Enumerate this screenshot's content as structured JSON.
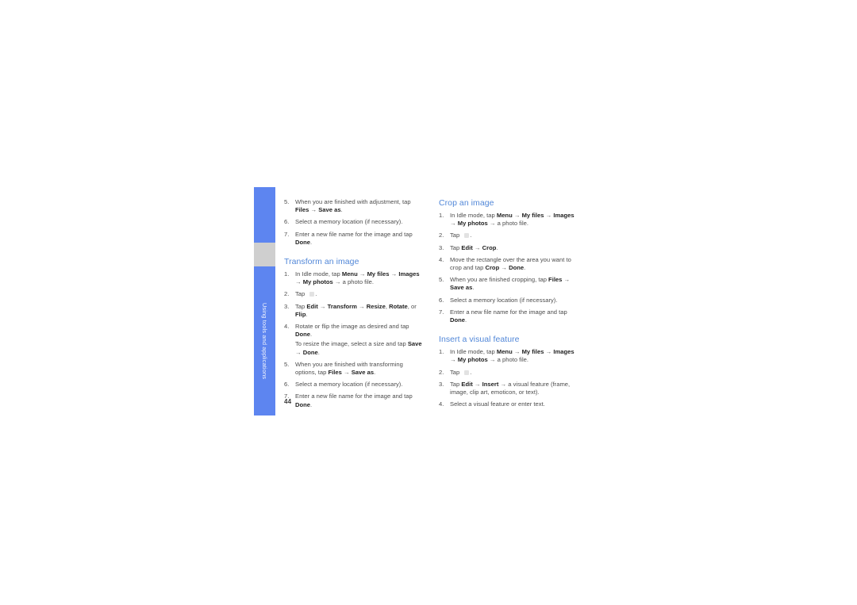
{
  "page": {
    "folio": "44",
    "heading_color": "#5187d8",
    "tab_color": "#5d85f0",
    "tab_gray_color": "#cfcfcf",
    "body_text_color": "#4d4d4d"
  },
  "side_tab": {
    "label": "Using tools and applications"
  },
  "left_column": {
    "continued_steps": [
      {
        "number": "5.",
        "parts": [
          {
            "t": "When you are finished with adjustment, tap ",
            "b": false
          },
          {
            "t": "Files",
            "b": true
          },
          {
            "t": " → ",
            "b": false
          },
          {
            "t": "Save as",
            "b": true
          },
          {
            "t": ".",
            "b": false
          }
        ]
      },
      {
        "number": "6.",
        "parts": [
          {
            "t": "Select a memory location (if necessary).",
            "b": false
          }
        ]
      },
      {
        "number": "7.",
        "parts": [
          {
            "t": "Enter a new file name for the image and tap ",
            "b": false
          },
          {
            "t": "Done",
            "b": true
          },
          {
            "t": ".",
            "b": false
          }
        ]
      }
    ],
    "section": {
      "heading": "Transform an image",
      "steps": [
        {
          "number": "1.",
          "parts": [
            {
              "t": "In Idle mode, tap ",
              "b": false
            },
            {
              "t": "Menu",
              "b": true
            },
            {
              "t": " → ",
              "b": false
            },
            {
              "t": "My files",
              "b": true
            },
            {
              "t": " → ",
              "b": false
            },
            {
              "t": "Images",
              "b": true
            },
            {
              "t": " → ",
              "b": false
            },
            {
              "t": "My photos",
              "b": true
            },
            {
              "t": " → a photo file.",
              "b": false
            }
          ]
        },
        {
          "number": "2.",
          "parts": [
            {
              "t": "Tap",
              "b": false
            },
            {
              "t": "[icon]",
              "b": false,
              "icon": true
            },
            {
              "t": ".",
              "b": false
            }
          ]
        },
        {
          "number": "3.",
          "parts": [
            {
              "t": "Tap ",
              "b": false
            },
            {
              "t": "Edit",
              "b": true
            },
            {
              "t": " → ",
              "b": false
            },
            {
              "t": "Transform",
              "b": true
            },
            {
              "t": " → ",
              "b": false
            },
            {
              "t": "Resize",
              "b": true
            },
            {
              "t": ", ",
              "b": false
            },
            {
              "t": "Rotate",
              "b": true
            },
            {
              "t": ", or ",
              "b": false
            },
            {
              "t": "Flip",
              "b": true
            },
            {
              "t": ".",
              "b": false
            }
          ]
        },
        {
          "number": "4.",
          "parts": [
            {
              "t": "Rotate or flip the image as desired and tap ",
              "b": false
            },
            {
              "t": "Done",
              "b": true
            },
            {
              "t": ".",
              "b": false
            }
          ],
          "note_parts": [
            {
              "t": "To resize the image, select a size and tap ",
              "b": false
            },
            {
              "t": "Save",
              "b": true
            },
            {
              "t": " → ",
              "b": false
            },
            {
              "t": "Done",
              "b": true
            },
            {
              "t": ".",
              "b": false
            }
          ]
        },
        {
          "number": "5.",
          "parts": [
            {
              "t": "When you are finished with transforming options, tap ",
              "b": false
            },
            {
              "t": "Files",
              "b": true
            },
            {
              "t": " → ",
              "b": false
            },
            {
              "t": "Save as",
              "b": true
            },
            {
              "t": ".",
              "b": false
            }
          ]
        },
        {
          "number": "6.",
          "parts": [
            {
              "t": "Select a memory location (if necessary).",
              "b": false
            }
          ]
        },
        {
          "number": "7.",
          "parts": [
            {
              "t": "Enter a new file name for the image and tap ",
              "b": false
            },
            {
              "t": "Done",
              "b": true
            },
            {
              "t": ".",
              "b": false
            }
          ]
        }
      ]
    }
  },
  "right_column": {
    "sections": [
      {
        "heading": "Crop an image",
        "steps": [
          {
            "number": "1.",
            "parts": [
              {
                "t": "In Idle mode, tap ",
                "b": false
              },
              {
                "t": "Menu",
                "b": true
              },
              {
                "t": " → ",
                "b": false
              },
              {
                "t": "My files",
                "b": true
              },
              {
                "t": " → ",
                "b": false
              },
              {
                "t": "Images",
                "b": true
              },
              {
                "t": " → ",
                "b": false
              },
              {
                "t": "My photos",
                "b": true
              },
              {
                "t": " → a photo file.",
                "b": false
              }
            ]
          },
          {
            "number": "2.",
            "parts": [
              {
                "t": "Tap",
                "b": false
              },
              {
                "t": "[icon]",
                "b": false,
                "icon": true
              },
              {
                "t": ".",
                "b": false
              }
            ]
          },
          {
            "number": "3.",
            "parts": [
              {
                "t": "Tap ",
                "b": false
              },
              {
                "t": "Edit",
                "b": true
              },
              {
                "t": " → ",
                "b": false
              },
              {
                "t": "Crop",
                "b": true
              },
              {
                "t": ".",
                "b": false
              }
            ]
          },
          {
            "number": "4.",
            "parts": [
              {
                "t": "Move the rectangle over the area you want to crop and tap ",
                "b": false
              },
              {
                "t": "Crop",
                "b": true
              },
              {
                "t": " → ",
                "b": false
              },
              {
                "t": "Done",
                "b": true
              },
              {
                "t": ".",
                "b": false
              }
            ]
          },
          {
            "number": "5.",
            "parts": [
              {
                "t": "When you are finished cropping, tap ",
                "b": false
              },
              {
                "t": "Files",
                "b": true
              },
              {
                "t": " → ",
                "b": false
              },
              {
                "t": "Save as",
                "b": true
              },
              {
                "t": ".",
                "b": false
              }
            ]
          },
          {
            "number": "6.",
            "parts": [
              {
                "t": "Select a memory location (if necessary).",
                "b": false
              }
            ]
          },
          {
            "number": "7.",
            "parts": [
              {
                "t": "Enter a new file name for the image and tap ",
                "b": false
              },
              {
                "t": "Done",
                "b": true
              },
              {
                "t": ".",
                "b": false
              }
            ]
          }
        ]
      },
      {
        "heading": "Insert a visual feature",
        "steps": [
          {
            "number": "1.",
            "parts": [
              {
                "t": "In Idle mode, tap ",
                "b": false
              },
              {
                "t": "Menu",
                "b": true
              },
              {
                "t": " → ",
                "b": false
              },
              {
                "t": "My files",
                "b": true
              },
              {
                "t": " → ",
                "b": false
              },
              {
                "t": "Images",
                "b": true
              },
              {
                "t": " → ",
                "b": false
              },
              {
                "t": "My photos",
                "b": true
              },
              {
                "t": " → a photo file.",
                "b": false
              }
            ]
          },
          {
            "number": "2.",
            "parts": [
              {
                "t": "Tap",
                "b": false
              },
              {
                "t": "[icon]",
                "b": false,
                "icon": true
              },
              {
                "t": ".",
                "b": false
              }
            ]
          },
          {
            "number": "3.",
            "parts": [
              {
                "t": "Tap ",
                "b": false
              },
              {
                "t": "Edit",
                "b": true
              },
              {
                "t": " → ",
                "b": false
              },
              {
                "t": "Insert",
                "b": true
              },
              {
                "t": " → a visual feature (frame, image, clip art, emoticon, or text).",
                "b": false
              }
            ]
          },
          {
            "number": "4.",
            "parts": [
              {
                "t": "Select a visual feature or enter text.",
                "b": false
              }
            ]
          }
        ]
      }
    ]
  }
}
